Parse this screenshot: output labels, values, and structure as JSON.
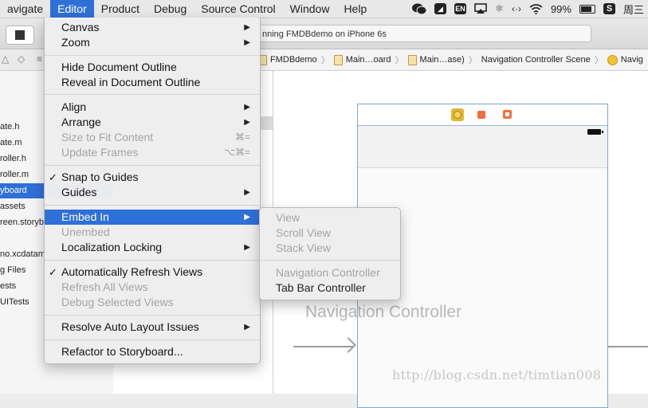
{
  "menubar": {
    "items": [
      "avigate",
      "Editor",
      "Product",
      "Debug",
      "Source Control",
      "Window",
      "Help"
    ],
    "active_index": 1,
    "status": {
      "input_method": "EN",
      "battery": "99%",
      "clock": "周三"
    }
  },
  "toolbar": {
    "status_text": "nning FMDBdemo on iPhone 6s"
  },
  "jumpbar": {
    "crumbs": [
      "FMDBdemo",
      "Main…oard",
      "Main…ase)",
      "Navigation Controller Scene",
      "Navig"
    ]
  },
  "navigator": {
    "files": [
      "ate.h",
      "ate.m",
      "roller.h",
      "roller.m",
      "yboard",
      "assets",
      "reen.storyb",
      "",
      "no.xcdatam",
      "g Files",
      "ests",
      "UITests"
    ],
    "selected_index": 4
  },
  "canvas": {
    "scene_title": "Navigation Controller",
    "watermark": "http://blog.csdn.net/timtian008"
  },
  "editor_menu": {
    "items": {
      "canvas": {
        "label": "Canvas"
      },
      "zoom": {
        "label": "Zoom"
      },
      "hide_outline": {
        "label": "Hide Document Outline"
      },
      "reveal_outline": {
        "label": "Reveal in Document Outline"
      },
      "align": {
        "label": "Align"
      },
      "arrange": {
        "label": "Arrange"
      },
      "size_to_fit": {
        "label": "Size to Fit Content",
        "shortcut": "⌘="
      },
      "update_frames": {
        "label": "Update Frames",
        "shortcut": "⌥⌘="
      },
      "snap_to_guides": {
        "label": "Snap to Guides",
        "check": "✓"
      },
      "guides": {
        "label": "Guides"
      },
      "embed_in": {
        "label": "Embed In"
      },
      "unembed": {
        "label": "Unembed"
      },
      "localization_locking": {
        "label": "Localization Locking"
      },
      "auto_refresh": {
        "label": "Automatically Refresh Views",
        "check": "✓"
      },
      "refresh_all": {
        "label": "Refresh All Views"
      },
      "debug_selected": {
        "label": "Debug Selected Views"
      },
      "resolve_auto_layout": {
        "label": "Resolve Auto Layout Issues"
      },
      "refactor": {
        "label": "Refactor to Storyboard..."
      }
    }
  },
  "embed_submenu": {
    "items": {
      "view": {
        "label": "View"
      },
      "scroll_view": {
        "label": "Scroll View"
      },
      "stack_view": {
        "label": "Stack View"
      },
      "navigation_controller": {
        "label": "Navigation Controller"
      },
      "tab_bar_controller": {
        "label": "Tab Bar Controller"
      }
    }
  },
  "colors": {
    "accent": "#2f6fd8",
    "disabled_text": "#a4a4a4"
  }
}
